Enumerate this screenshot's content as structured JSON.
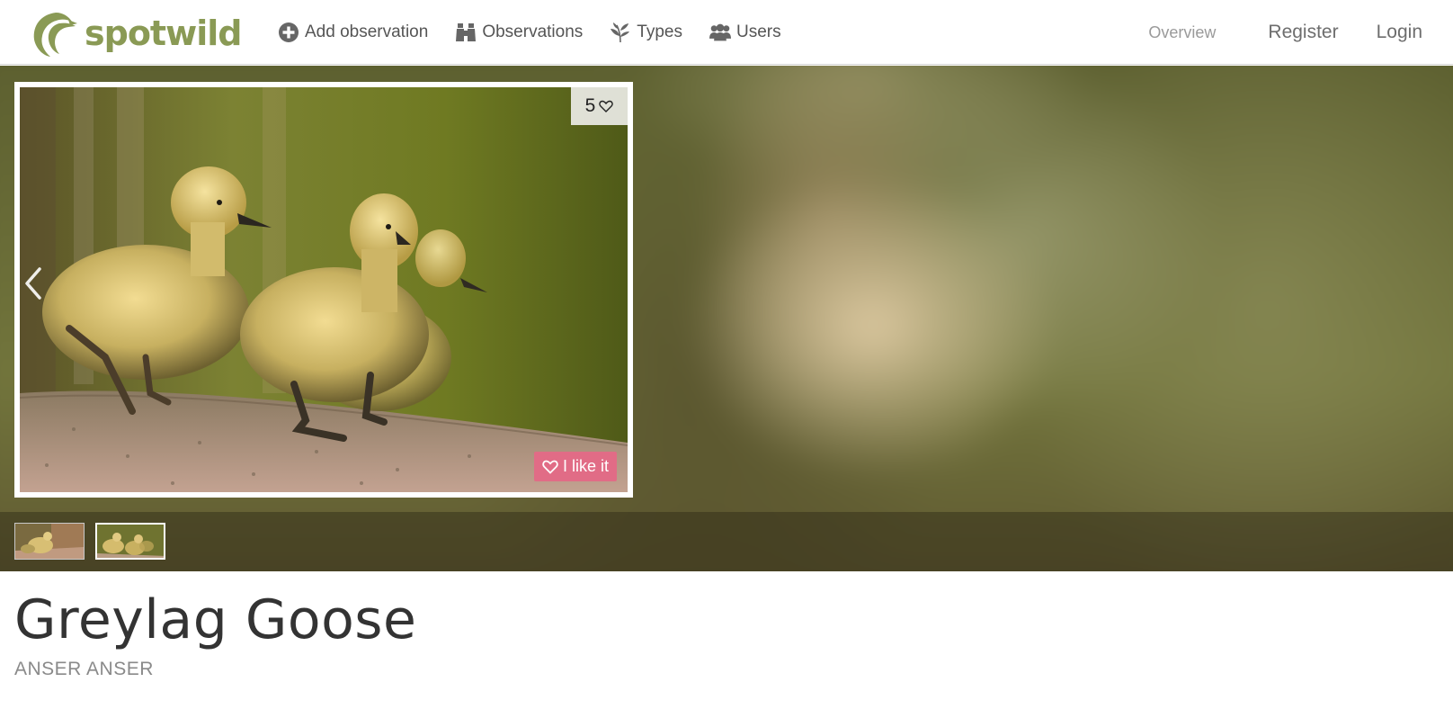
{
  "brand": {
    "name": "spotwild",
    "color": "#8a9a55"
  },
  "nav": {
    "left": [
      {
        "icon": "plus-circle-icon",
        "label": "Add observation"
      },
      {
        "icon": "binoculars-icon",
        "label": "Observations"
      },
      {
        "icon": "leaf-icon",
        "label": "Types"
      },
      {
        "icon": "users-icon",
        "label": "Users"
      }
    ],
    "right": {
      "overview": "Overview",
      "register": "Register",
      "login": "Login"
    }
  },
  "gallery": {
    "likes_count": "5",
    "like_button": "I like it",
    "thumbnails": [
      {
        "alt": "goslings-thumbnail-1",
        "selected": false
      },
      {
        "alt": "goslings-thumbnail-2",
        "selected": true
      }
    ]
  },
  "species": {
    "name": "Greylag Goose",
    "latin": "ANSER ANSER"
  },
  "colors": {
    "accent_green": "#8a9a55",
    "like_pink": "#e16c86"
  }
}
